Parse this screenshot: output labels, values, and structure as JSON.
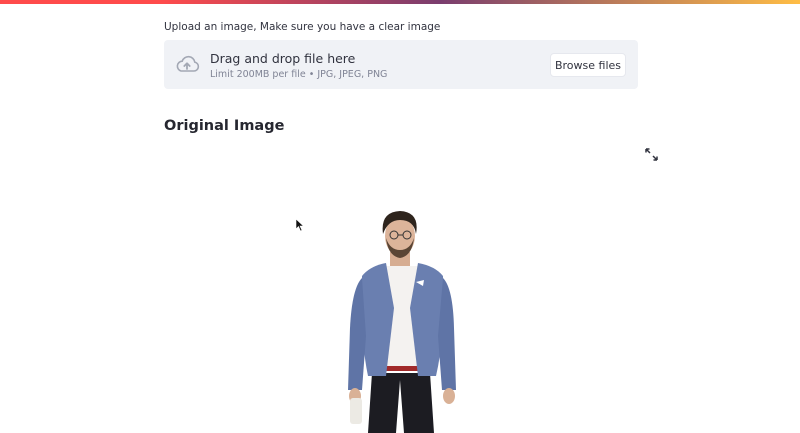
{
  "upload": {
    "label": "Upload an image, Make sure you have a clear image",
    "drop_title": "Drag and drop file here",
    "limit_text": "Limit 200MB per file • JPG, JPEG, PNG",
    "browse_label": "Browse files",
    "icon": "cloud-upload-icon"
  },
  "section": {
    "title": "Original Image",
    "fullscreen_icon": "fullscreen-icon",
    "image": "person-in-blue-blazer-photo"
  },
  "colors": {
    "dropzone_bg": "#f0f2f6",
    "text": "#31333f",
    "muted": "#808495",
    "accent_red": "#ff4b4b"
  }
}
